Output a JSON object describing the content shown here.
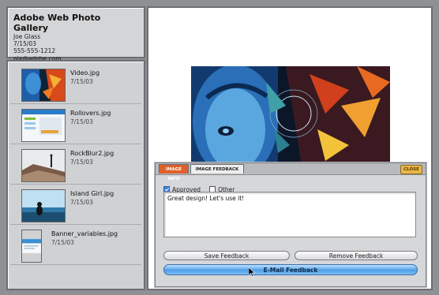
{
  "header": {
    "title": "Adobe Web Photo Gallery",
    "author": "Joe Glass",
    "date": "7/15/03",
    "phone": "555-555-1212",
    "email": "pix@adobe.com"
  },
  "thumbnails": [
    {
      "name": "Video.jpg",
      "date": "7/15/03"
    },
    {
      "name": "Rollovers.jpg",
      "date": "7/15/03"
    },
    {
      "name": "RockBlur2.jpg",
      "date": "7/15/03"
    },
    {
      "name": "Island Girl.jpg",
      "date": "7/15/03"
    },
    {
      "name": "Banner_variables.jpg",
      "date": "7/15/03"
    }
  ],
  "feedback": {
    "tabs": {
      "info": "IMAGE INFO",
      "feedback": "IMAGE FEEDBACK",
      "close": "CLOSE"
    },
    "approved_label": "Approved",
    "approved_checked": true,
    "other_label": "Other",
    "other_checked": false,
    "text": "Great design! Let's use it!",
    "save_label": "Save Feedback",
    "remove_label": "Remove Feedback",
    "email_label": "E-Mail Feedback"
  },
  "colors": {
    "accent_tab": "#e0602a",
    "email_button": "#4e9fe8",
    "close_button": "#e8b64a"
  }
}
